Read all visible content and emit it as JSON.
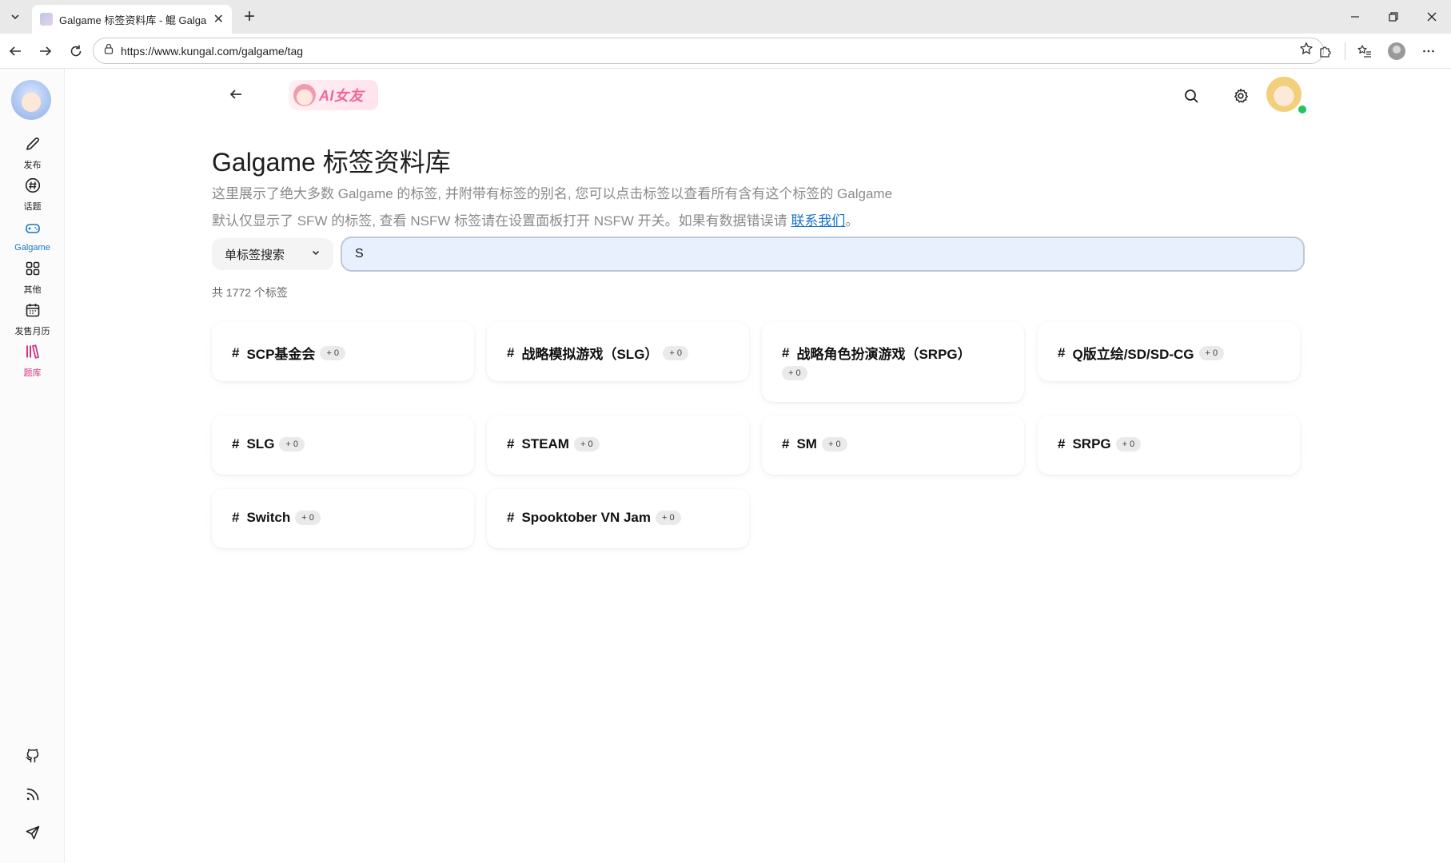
{
  "browser": {
    "tab_title": "Galgame 标签资料库 - 鲲 Galgame",
    "url_prefix": "https://",
    "url_host": "www.kungal.com",
    "url_path": "/galgame/tag"
  },
  "sidebar": {
    "items": [
      {
        "label": "发布",
        "icon": "pencil-icon"
      },
      {
        "label": "话题",
        "icon": "hash-icon"
      },
      {
        "label": "Galgame",
        "icon": "gamepad-icon"
      },
      {
        "label": "其他",
        "icon": "grid-icon"
      },
      {
        "label": "发售月历",
        "icon": "calendar-icon"
      },
      {
        "label": "题库",
        "icon": "library-icon"
      }
    ],
    "bottom_icons": [
      "github-icon",
      "rss-icon",
      "send-icon"
    ],
    "active_color": "#1a73c8",
    "highlight_color": "#d0378a"
  },
  "header": {
    "banner_text": "AI女友"
  },
  "main": {
    "title": "Galgame 标签资料库",
    "desc1": "这里展示了绝大多数 Galgame 的标签, 并附带有标签的别名, 您可以点击标签以查看所有含有这个标签的 Galgame",
    "desc2_prefix": "默认仅显示了 SFW 的标签, 查看 NSFW 标签请在设置面板打开 NSFW 开关。如果有数据错误请 ",
    "desc2_link": "联系我们",
    "desc2_suffix": "。",
    "search_mode": "单标签搜索",
    "search_value": "S",
    "count_text": "共 1772 个标签"
  },
  "tags": [
    {
      "hash": "#",
      "name": "SCP基金会",
      "count": "+ 0"
    },
    {
      "hash": "#",
      "name": "战略模拟游戏（SLG）",
      "count": "+ 0"
    },
    {
      "hash": "#",
      "name": "战略角色扮演游戏（SRPG）",
      "count": "+ 0"
    },
    {
      "hash": "#",
      "name": "Q版立绘/SD/SD-CG",
      "count": "+ 0"
    },
    {
      "hash": "#",
      "name": "SLG",
      "count": "+ 0"
    },
    {
      "hash": "#",
      "name": "STEAM",
      "count": "+ 0"
    },
    {
      "hash": "#",
      "name": "SM",
      "count": "+ 0"
    },
    {
      "hash": "#",
      "name": "SRPG",
      "count": "+ 0"
    },
    {
      "hash": "#",
      "name": "Switch",
      "count": "+ 0"
    },
    {
      "hash": "#",
      "name": "Spooktober VN Jam",
      "count": "+ 0"
    }
  ]
}
